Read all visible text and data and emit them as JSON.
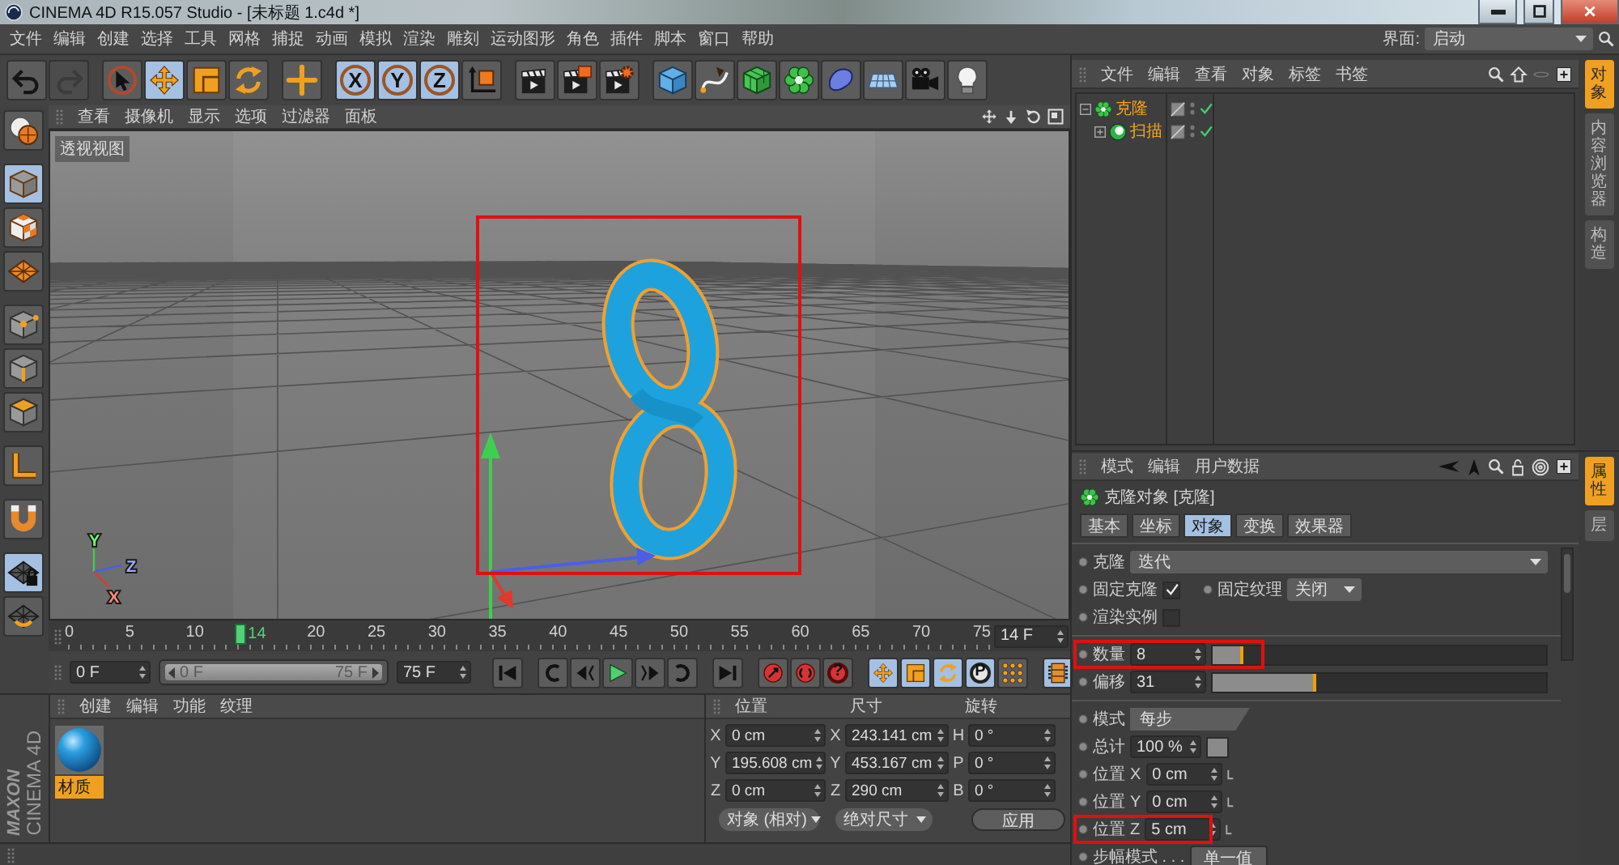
{
  "window": {
    "title": "CINEMA 4D R15.057 Studio - [未标题 1.c4d *]"
  },
  "menu_bar": {
    "items": [
      "文件",
      "编辑",
      "创建",
      "选择",
      "工具",
      "网格",
      "捕捉",
      "动画",
      "模拟",
      "渲染",
      "雕刻",
      "运动图形",
      "角色",
      "插件",
      "脚本",
      "窗口",
      "帮助"
    ],
    "layout_label": "界面:",
    "layout_value": "启动"
  },
  "toolbar": [
    [
      {
        "kind": "undo",
        "selected": false,
        "disabled": false
      },
      {
        "kind": "redo",
        "selected": false,
        "disabled": true
      }
    ],
    [
      {
        "kind": "select",
        "selected": false,
        "disabled": false
      },
      {
        "kind": "move",
        "selected": true,
        "disabled": false
      },
      {
        "kind": "scale",
        "selected": false,
        "disabled": false
      },
      {
        "kind": "rotate",
        "selected": false,
        "disabled": false
      }
    ],
    [
      {
        "kind": "recent",
        "selected": false,
        "disabled": false
      }
    ],
    [
      {
        "kind": "xaxis",
        "label": "X",
        "selected": true,
        "disabled": false
      },
      {
        "kind": "yaxis",
        "label": "Y",
        "selected": true,
        "disabled": false
      },
      {
        "kind": "zaxis",
        "label": "Z",
        "selected": true,
        "disabled": false
      },
      {
        "kind": "coords",
        "selected": false,
        "disabled": false
      }
    ],
    [
      {
        "kind": "renderview",
        "selected": false,
        "disabled": false
      },
      {
        "kind": "render",
        "selected": false,
        "disabled": false
      },
      {
        "kind": "rendersettings",
        "selected": false,
        "disabled": false
      }
    ],
    [
      {
        "kind": "cube",
        "selected": false,
        "disabled": false
      },
      {
        "kind": "pen",
        "selected": false,
        "disabled": false
      },
      {
        "kind": "subdiv",
        "selected": false,
        "disabled": false
      },
      {
        "kind": "cloner",
        "selected": false,
        "disabled": false
      },
      {
        "kind": "deformer",
        "selected": false,
        "disabled": false
      },
      {
        "kind": "floor",
        "selected": false,
        "disabled": false
      },
      {
        "kind": "camera",
        "selected": false,
        "disabled": false
      },
      {
        "kind": "light",
        "selected": false,
        "disabled": false
      }
    ]
  ],
  "mode_toolbar": [
    [
      {
        "kind": "editable",
        "selected": false
      }
    ],
    [
      {
        "kind": "model",
        "selected": true
      },
      {
        "kind": "texture",
        "selected": false
      },
      {
        "kind": "workplane",
        "selected": false
      }
    ],
    [
      {
        "kind": "points",
        "selected": false
      },
      {
        "kind": "edges",
        "selected": false
      },
      {
        "kind": "polygons",
        "selected": false
      }
    ],
    [
      {
        "kind": "axis",
        "selected": false
      }
    ],
    [
      {
        "kind": "snap",
        "selected": false
      }
    ],
    [
      {
        "kind": "lock",
        "selected": true
      },
      {
        "kind": "planar",
        "selected": false
      }
    ]
  ],
  "viewport": {
    "menu": [
      "查看",
      "摄像机",
      "显示",
      "选项",
      "过滤器",
      "面板"
    ],
    "label": "透视视图",
    "axis_labels": [
      "Y",
      "X",
      "Z"
    ],
    "object_highlighted": true
  },
  "timeline": {
    "marks": [
      {
        "kind": "tick",
        "label": "0"
      },
      {
        "kind": "tick",
        "label": "5"
      },
      {
        "kind": "tick",
        "label": "10"
      },
      {
        "kind": "playhead",
        "label": "14"
      },
      {
        "kind": "tick",
        "label": "20"
      },
      {
        "kind": "tick",
        "label": "25"
      },
      {
        "kind": "tick",
        "label": "30"
      },
      {
        "kind": "tick",
        "label": "35"
      },
      {
        "kind": "tick",
        "label": "40"
      },
      {
        "kind": "tick",
        "label": "45"
      },
      {
        "kind": "tick",
        "label": "50"
      },
      {
        "kind": "tick",
        "label": "55"
      },
      {
        "kind": "tick",
        "label": "60"
      },
      {
        "kind": "tick",
        "label": "65"
      },
      {
        "kind": "tick",
        "label": "70"
      },
      {
        "kind": "tick",
        "label": "75"
      }
    ],
    "current_frame": "14 F"
  },
  "transport": {
    "start_field": "0 F",
    "range": {
      "start": "0 F",
      "end": "75 F",
      "level": 1
    },
    "end_field": "75 F",
    "buttons": [
      [
        {
          "kind": "start",
          "selected": false
        }
      ],
      [
        {
          "kind": "prevkey",
          "selected": false
        },
        {
          "kind": "prevframe",
          "selected": false
        },
        {
          "kind": "play",
          "selected": false
        },
        {
          "kind": "nextframe",
          "selected": false
        },
        {
          "kind": "nextkey",
          "selected": false
        }
      ],
      [
        {
          "kind": "end",
          "selected": false
        }
      ],
      [
        {
          "kind": "record",
          "selected": false
        },
        {
          "kind": "autokey",
          "selected": false
        },
        {
          "kind": "keysel",
          "label": "?",
          "selected": false
        }
      ],
      [
        {
          "kind": "keymove",
          "selected": true
        },
        {
          "kind": "keyscale",
          "selected": true
        },
        {
          "kind": "keyrotate",
          "selected": true
        },
        {
          "kind": "keyparam",
          "label": "P",
          "selected": true
        },
        {
          "kind": "keypoints",
          "selected": false
        }
      ],
      [
        {
          "kind": "timeline",
          "selected": true
        }
      ]
    ]
  },
  "logo": {
    "brand": "MAXON",
    "product": "CINEMA 4D"
  },
  "material_manager": {
    "menu": [
      "创建",
      "编辑",
      "功能",
      "纹理"
    ],
    "materials": [
      {
        "name": "材质",
        "selected": true
      }
    ]
  },
  "coordinates": {
    "headers": [
      "位置",
      "尺寸",
      "旋转"
    ],
    "rows": [
      {
        "position_axis": "X",
        "position": "0 cm",
        "size_axis": "X",
        "size": "243.141 cm",
        "rotation_axis": "H",
        "rotation": "0 °"
      },
      {
        "position_axis": "Y",
        "position": "195.608 cm",
        "size_axis": "Y",
        "size": "453.167 cm",
        "rotation_axis": "P",
        "rotation": "0 °"
      },
      {
        "position_axis": "Z",
        "position": "0 cm",
        "size_axis": "Z",
        "size": "290 cm",
        "rotation_axis": "B",
        "rotation": "0 °"
      }
    ],
    "position_mode": "对象 (相对)",
    "size_mode": "绝对尺寸",
    "apply": "应用"
  },
  "object_manager": {
    "menu": [
      "文件",
      "编辑",
      "查看",
      "对象",
      "标签",
      "书签"
    ],
    "objects": [
      {
        "name": "克隆",
        "kind": "cloner",
        "selected": true,
        "expanded": true,
        "enabled": true,
        "children": [
          {
            "name": "扫描",
            "kind": "sweep",
            "selected": true,
            "expanded": false,
            "enabled": true
          }
        ]
      }
    ],
    "side_tabs": [
      {
        "label": "对象",
        "selected": true
      },
      {
        "label": "内容浏览器",
        "selected": false
      },
      {
        "label": "构造",
        "selected": false
      }
    ]
  },
  "attributes": {
    "menu": [
      "模式",
      "编辑",
      "用户数据"
    ],
    "object_title": "克隆对象 [克隆]",
    "tabs": [
      {
        "label": "基本",
        "selected": false
      },
      {
        "label": "坐标",
        "selected": false
      },
      {
        "label": "对象",
        "selected": true
      },
      {
        "label": "变换",
        "selected": false
      },
      {
        "label": "效果器",
        "selected": false
      }
    ],
    "sections": [
      [
        {
          "kind": "dropdown",
          "label": "克隆",
          "value": "迭代",
          "highlighted": false
        },
        {
          "kind": "checkdrop",
          "label": "固定克隆",
          "checked": true,
          "label_2": "固定纹理",
          "value": "关闭",
          "highlighted": false
        },
        {
          "kind": "checkbox",
          "label": "渲染实例",
          "checked": false,
          "highlighted": false
        }
      ],
      [
        {
          "kind": "slider",
          "label": "数量",
          "value": "8",
          "level": 0.09,
          "highlighted": true
        },
        {
          "kind": "slider",
          "label": "偏移",
          "value": "31",
          "level": 0.31,
          "highlighted": false
        }
      ],
      [
        {
          "kind": "mode",
          "label": "模式",
          "value": "每步",
          "highlighted": false
        },
        {
          "kind": "percent",
          "label": "总计",
          "value": "100 %",
          "highlighted": false
        },
        {
          "kind": "vector",
          "label": "位置",
          "axis": "X",
          "value": "0 cm",
          "highlighted": false
        },
        {
          "kind": "vector",
          "label": "位置",
          "axis": "Y",
          "value": "0 cm",
          "highlighted": false
        },
        {
          "kind": "vector",
          "label": "位置",
          "axis": "Z",
          "value": "5 cm",
          "highlighted": true
        },
        {
          "kind": "button",
          "label": "步幅模式 . . .",
          "value": "单一值",
          "highlighted": false
        }
      ]
    ],
    "side_tabs": [
      {
        "label": "属性",
        "selected": true
      },
      {
        "label": "层",
        "selected": false
      }
    ]
  }
}
